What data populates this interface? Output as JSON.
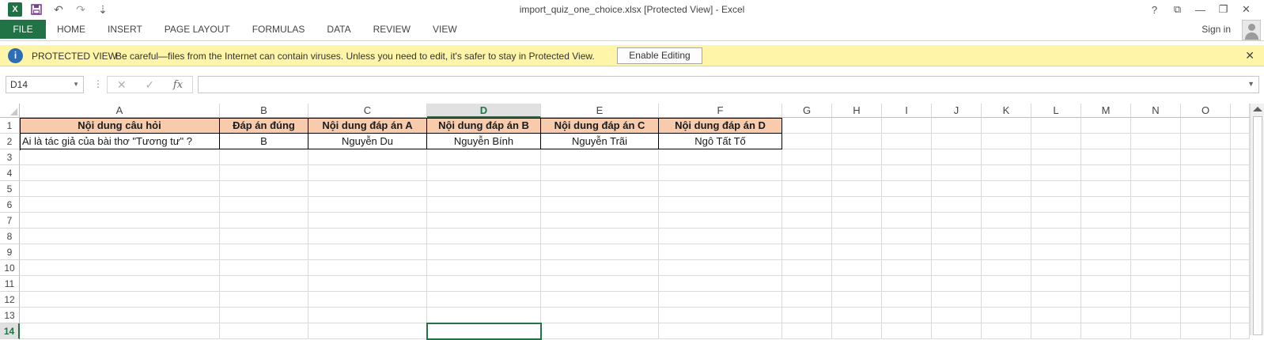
{
  "window": {
    "title": "import_quiz_one_choice.xlsx  [Protected View] - Excel",
    "controls": [
      "?",
      "⧉",
      "—",
      "❐",
      "✕"
    ]
  },
  "qat": {
    "undo": "↶",
    "redo": "↷",
    "customize": "⇣"
  },
  "ribbon": {
    "file": "FILE",
    "tabs": [
      "HOME",
      "INSERT",
      "PAGE LAYOUT",
      "FORMULAS",
      "DATA",
      "REVIEW",
      "VIEW"
    ],
    "sign_in": "Sign in"
  },
  "protected_view": {
    "title": "PROTECTED VIEW",
    "message": "Be careful—files from the Internet can contain viruses. Unless you need to edit, it's safer to stay in Protected View.",
    "button": "Enable Editing",
    "close": "✕"
  },
  "formula_bar": {
    "name_box": "D14",
    "formula": ""
  },
  "sheet": {
    "columns": [
      "A",
      "B",
      "C",
      "D",
      "E",
      "F",
      "G",
      "H",
      "I",
      "J",
      "K",
      "L",
      "M",
      "N",
      "O"
    ],
    "selected_column": "D",
    "rows": [
      "1",
      "2",
      "3",
      "4",
      "5",
      "6",
      "7",
      "8",
      "9",
      "10",
      "11",
      "12",
      "13",
      "14"
    ],
    "selected_row": "14",
    "header_row": [
      "Nội dung câu hỏi",
      "Đáp án đúng",
      "Nội dung đáp án A",
      "Nội dung đáp án B",
      "Nội dung đáp án C",
      "Nội dung đáp án D"
    ],
    "data_row": [
      "Ai là tác giả của bài thơ \"Tương tư\" ?",
      "B",
      "Nguyễn Du",
      "Nguyễn Bính",
      "Nguyễn Trãi",
      "Ngô Tất Tố"
    ],
    "header_fill": "#f8cbad",
    "selection_color": "#217346"
  }
}
